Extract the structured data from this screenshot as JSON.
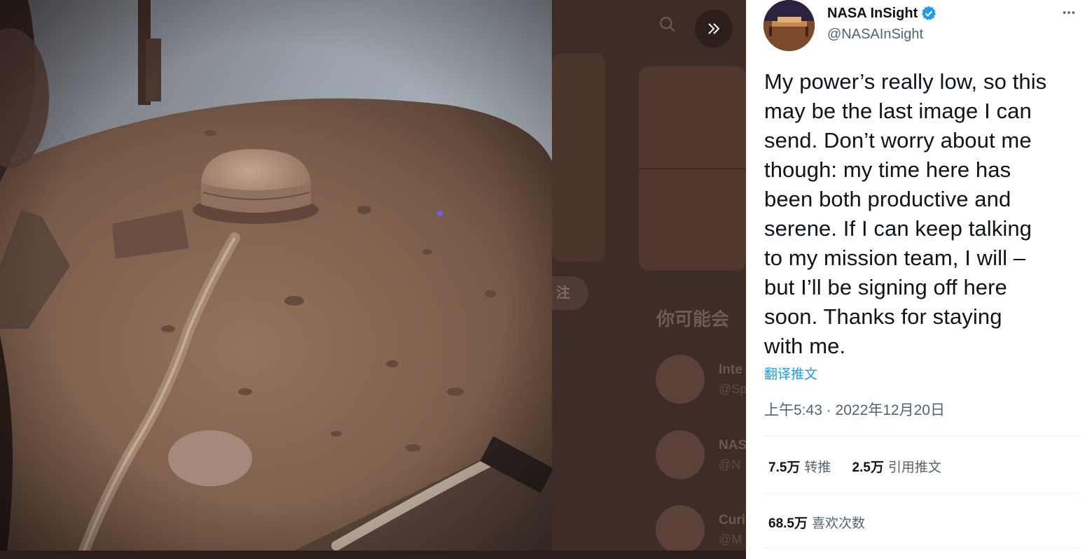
{
  "colors": {
    "accent": "#1d9bf0",
    "verified": "#1d9bf0",
    "text_primary": "#0f1419",
    "text_secondary": "#536471"
  },
  "photo": {
    "alt": "Last selfie of the InSight lander on Mars: dusty dome seismometer on the Martian surface"
  },
  "dimmed_background": {
    "follow_button": "注",
    "section_heading": "你可能会",
    "suggestions": [
      {
        "name": "Inte",
        "handle": "@Sp"
      },
      {
        "name": "NAS",
        "handle": "@N"
      },
      {
        "name": "Curi",
        "handle": "@M"
      }
    ]
  },
  "tweet": {
    "author": {
      "name": "NASA InSight",
      "handle": "@NASAInSight",
      "verified": true
    },
    "text": "My power’s really low, so this\nmay be the last image I can\nsend. Don’t worry about me\nthough: my time here has\nbeen both productive and\nserene. If I can keep talking\nto my mission team, I will –\nbut I’ll be signing off here\nsoon. Thanks for staying\nwith me.",
    "translate_label": "翻译推文",
    "timestamp": "上午5:43 · 2022年12月20日",
    "stats": {
      "retweets_value": "7.5万",
      "retweets_label": "转推",
      "quotes_value": "2.5万",
      "quotes_label": "引用推文",
      "likes_value": "68.5万",
      "likes_label": "喜欢次数"
    }
  }
}
